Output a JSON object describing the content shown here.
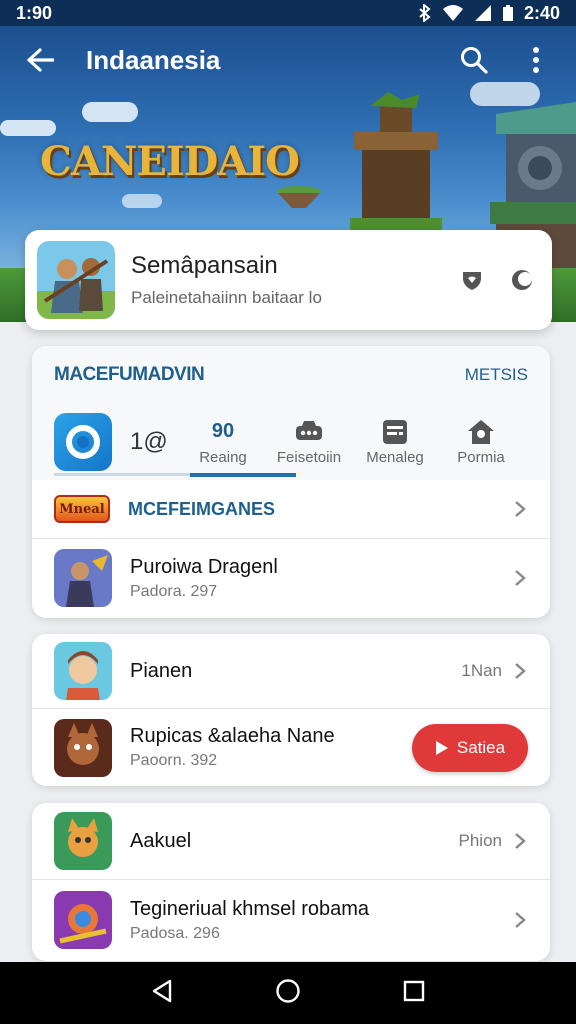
{
  "status_bar": {
    "time_left": "1:90",
    "time_right": "2:40"
  },
  "toolbar": {
    "title": "Indaanesia"
  },
  "hero": {
    "logo_text": "CANEIDAIO"
  },
  "featured": {
    "title": "Semâpansain",
    "subtitle": "Paleinetahaiinn baitaar lo"
  },
  "section": {
    "title": "MACEFUMADVIN",
    "action": "METSIS"
  },
  "tabs": {
    "count": "1@",
    "items": [
      {
        "top": "90",
        "label": "Reaing"
      },
      {
        "icon": "bus-icon",
        "label": "Feisetoiin"
      },
      {
        "icon": "list-icon",
        "label": "Menaleg"
      },
      {
        "icon": "home-icon",
        "label": "Pormia"
      }
    ]
  },
  "games": {
    "badge": "Mneal",
    "title": "MCEFEIMGANES",
    "items": [
      {
        "title": "Puroiwa Dragenl",
        "sub": "Padora. 297"
      }
    ]
  },
  "list2": [
    {
      "title": "Pianen",
      "meta": "1Nan"
    },
    {
      "title": "Rupicas &alaeha Nane",
      "sub": "Paoorn. 392",
      "button": "Satiea"
    }
  ],
  "list3": [
    {
      "title": "Aakuel",
      "meta": "Phion"
    },
    {
      "title": "Tegineriual khmsel robama",
      "sub": "Padosa. 296"
    }
  ],
  "colors": {
    "accent": "#1e5f8e",
    "play": "#e0393a",
    "status_bg": "#0d2f57"
  }
}
